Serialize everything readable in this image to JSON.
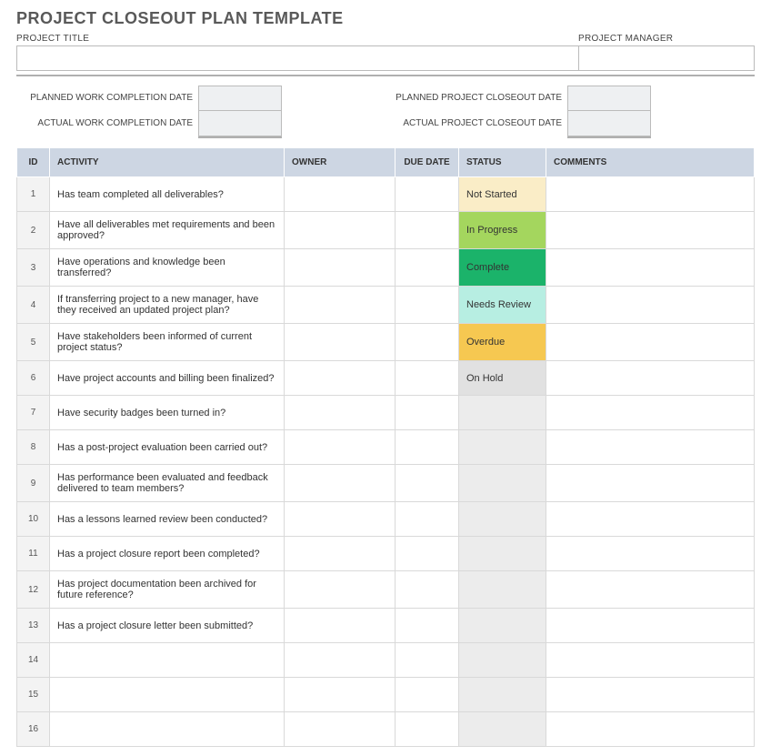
{
  "title": "PROJECT CLOSEOUT PLAN TEMPLATE",
  "header": {
    "project_title": {
      "label": "PROJECT TITLE",
      "value": ""
    },
    "project_manager": {
      "label": "PROJECT MANAGER",
      "value": ""
    }
  },
  "dates": {
    "planned_work": {
      "label": "PLANNED WORK COMPLETION DATE",
      "value": ""
    },
    "planned_project": {
      "label": "PLANNED PROJECT CLOSEOUT DATE",
      "value": ""
    },
    "actual_work": {
      "label": "ACTUAL WORK COMPLETION DATE",
      "value": ""
    },
    "actual_project": {
      "label": "ACTUAL PROJECT CLOSEOUT DATE",
      "value": ""
    }
  },
  "columns": {
    "id": "ID",
    "activity": "ACTIVITY",
    "owner": "OWNER",
    "due": "DUE DATE",
    "status": "STATUS",
    "comments": "COMMENTS"
  },
  "status_styles": {
    "Not Started": "st-not-started",
    "In Progress": "st-in-progress",
    "Complete": "st-complete",
    "Needs Review": "st-needs-review",
    "Overdue": "st-overdue",
    "On Hold": "st-on-hold"
  },
  "rows": [
    {
      "id": "1",
      "activity": "Has team completed all deliverables?",
      "owner": "",
      "due": "",
      "status": "Not Started",
      "comments": ""
    },
    {
      "id": "2",
      "activity": "Have all deliverables met requirements and been approved?",
      "owner": "",
      "due": "",
      "status": "In Progress",
      "comments": ""
    },
    {
      "id": "3",
      "activity": "Have operations and knowledge been transferred?",
      "owner": "",
      "due": "",
      "status": "Complete",
      "comments": ""
    },
    {
      "id": "4",
      "activity": "If transferring project to a new manager, have they received an updated project plan?",
      "owner": "",
      "due": "",
      "status": "Needs Review",
      "comments": ""
    },
    {
      "id": "5",
      "activity": "Have stakeholders been informed of current project status?",
      "owner": "",
      "due": "",
      "status": "Overdue",
      "comments": ""
    },
    {
      "id": "6",
      "activity": "Have project accounts and billing been finalized?",
      "owner": "",
      "due": "",
      "status": "On Hold",
      "comments": ""
    },
    {
      "id": "7",
      "activity": "Have security badges been turned in?",
      "owner": "",
      "due": "",
      "status": "",
      "comments": ""
    },
    {
      "id": "8",
      "activity": "Has a post-project evaluation been carried out?",
      "owner": "",
      "due": "",
      "status": "",
      "comments": ""
    },
    {
      "id": "9",
      "activity": "Has performance been evaluated and feedback delivered to team members?",
      "owner": "",
      "due": "",
      "status": "",
      "comments": ""
    },
    {
      "id": "10",
      "activity": "Has a lessons learned review been conducted?",
      "owner": "",
      "due": "",
      "status": "",
      "comments": ""
    },
    {
      "id": "11",
      "activity": "Has a project closure report been completed?",
      "owner": "",
      "due": "",
      "status": "",
      "comments": ""
    },
    {
      "id": "12",
      "activity": "Has project documentation been archived for future reference?",
      "owner": "",
      "due": "",
      "status": "",
      "comments": ""
    },
    {
      "id": "13",
      "activity": "Has a project closure letter been submitted?",
      "owner": "",
      "due": "",
      "status": "",
      "comments": ""
    },
    {
      "id": "14",
      "activity": "",
      "owner": "",
      "due": "",
      "status": "",
      "comments": ""
    },
    {
      "id": "15",
      "activity": "",
      "owner": "",
      "due": "",
      "status": "",
      "comments": ""
    },
    {
      "id": "16",
      "activity": "",
      "owner": "",
      "due": "",
      "status": "",
      "comments": ""
    }
  ]
}
